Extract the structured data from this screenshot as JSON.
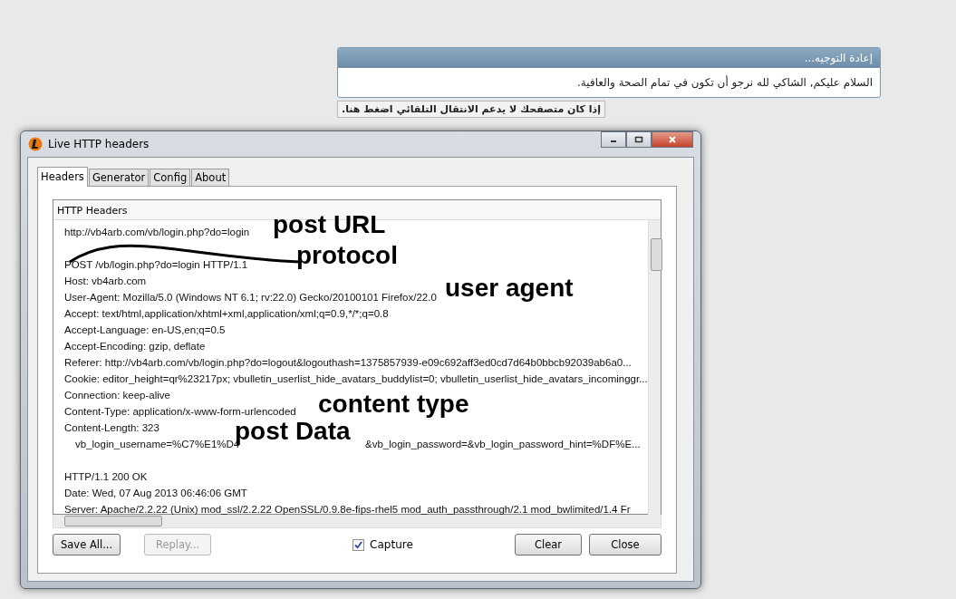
{
  "redirect": {
    "title": "إعادة التوجيه...",
    "message": "السلام عليكم, الشاكي لله نرجو أن تكون في تمام الصحة والعافية.",
    "link_button": "إذا كان متصفحك لا يدعم الانتقال التلقائي اضغط هنا."
  },
  "window": {
    "title": "Live HTTP headers"
  },
  "tabs": [
    {
      "label": "Headers",
      "selected": true
    },
    {
      "label": "Generator",
      "selected": false
    },
    {
      "label": "Config",
      "selected": false
    },
    {
      "label": "About",
      "selected": false
    }
  ],
  "panel": {
    "heading": "HTTP Headers",
    "lines": [
      {
        "text": "http://vb4arb.com/vb/login.php?do=login"
      },
      {
        "text": "POST /vb/login.php?do=login HTTP/1.1",
        "spaced": true
      },
      {
        "text": "Host: vb4arb.com"
      },
      {
        "text": "User-Agent: Mozilla/5.0 (Windows NT 6.1; rv:22.0) Gecko/20100101 Firefox/22.0"
      },
      {
        "text": "Accept: text/html,application/xhtml+xml,application/xml;q=0.9,*/*;q=0.8"
      },
      {
        "text": "Accept-Language: en-US,en;q=0.5"
      },
      {
        "text": "Accept-Encoding: gzip, deflate"
      },
      {
        "text": "Referer: http://vb4arb.com/vb/login.php?do=logout&logouthash=1375857939-e09c692aff3ed0cd7d64b0bbcb92039ab6a0..."
      },
      {
        "text": "Cookie: editor_height=qr%23217px; vbulletin_userlist_hide_avatars_buddylist=0; vbulletin_userlist_hide_avatars_incominggr..."
      },
      {
        "text": "Connection: keep-alive"
      },
      {
        "text": "Content-Type: application/x-www-form-urlencoded"
      },
      {
        "text": "Content-Length: 323"
      },
      {
        "text": "vb_login_username=%C7%E1%D4",
        "rest": "&vb_login_password=&vb_login_password_hint=%DF%E...",
        "indent": true
      },
      {
        "text": "HTTP/1.1 200 OK",
        "spaced": true
      },
      {
        "text": "Date: Wed, 07 Aug 2013 06:46:06 GMT"
      },
      {
        "text": "Server: Apache/2.2.22 (Unix) mod_ssl/2.2.22 OpenSSL/0.9.8e-fips-rhel5 mod_auth_passthrough/2.1 mod_bwlimited/1.4 Fr"
      }
    ]
  },
  "annotations": [
    "post URL",
    "protocol",
    "user agent",
    "content type",
    "post Data"
  ],
  "buttons": {
    "save": {
      "label": "Save All...",
      "disabled": false
    },
    "replay": {
      "label": "Replay...",
      "disabled": true
    },
    "clear": {
      "label": "Clear",
      "disabled": false
    },
    "close": {
      "label": "Close",
      "disabled": false
    }
  },
  "capture": {
    "label": "Capture",
    "checked": true
  }
}
